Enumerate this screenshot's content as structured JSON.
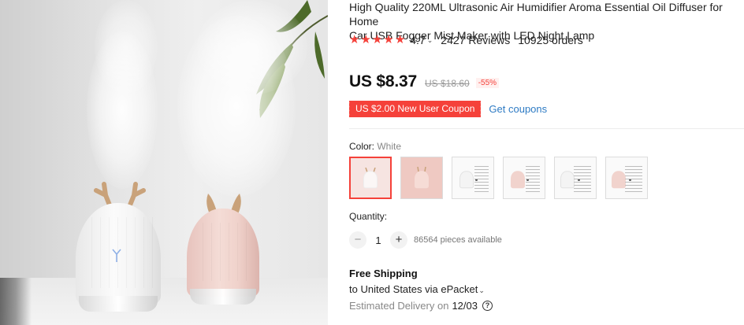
{
  "product": {
    "title_line1": "High Quality 220ML Ultrasonic Air Humidifier Aroma Essential Oil Diffuser for Home",
    "title_line2": "Car USB Fogger Mist Maker with LED Night Lamp",
    "rating": "4.7",
    "reviews": "2427 Reviews",
    "orders": "10925 orders",
    "star_count": 5,
    "star_color": "#f5413a"
  },
  "pricing": {
    "price": "US $8.37",
    "old_price": "US $18.60",
    "discount": "-55%",
    "coupon": "US $2.00 New User Coupon",
    "get_coupons": "Get coupons",
    "accent": "#f5413a",
    "link_color": "#2e7bc4"
  },
  "options": {
    "color_label": "Color:",
    "color_value": "White",
    "swatches": [
      {
        "icon": "white-humidifier",
        "selected": true
      },
      {
        "icon": "pink-humidifier",
        "selected": false
      },
      {
        "icon": "white-humidifier-with-sticks",
        "selected": false
      },
      {
        "icon": "pink-humidifier-with-sticks",
        "selected": false
      },
      {
        "icon": "white-humidifier-with-sticks",
        "selected": false
      },
      {
        "icon": "pink-humidifier-with-sticks",
        "selected": false
      }
    ]
  },
  "quantity": {
    "label": "Quantity:",
    "minus": "−",
    "value": "1",
    "plus": "+",
    "available": "86564 pieces available"
  },
  "shipping": {
    "title": "Free Shipping",
    "to": "to United States via ePacket",
    "delivery_label": "Estimated Delivery on",
    "delivery_date": "12/03",
    "help": "?"
  }
}
